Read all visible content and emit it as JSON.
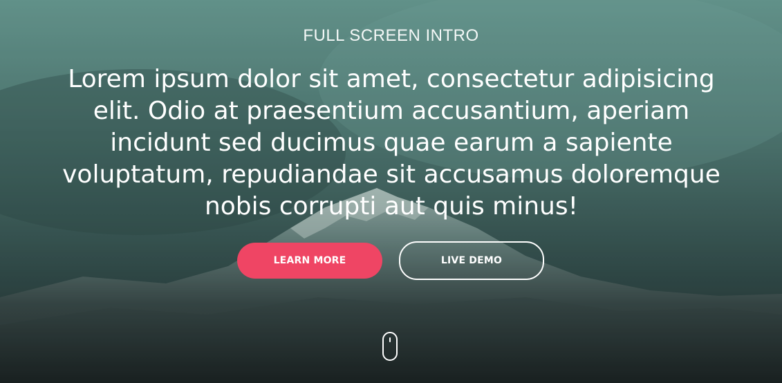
{
  "hero": {
    "eyebrow": "FULL SCREEN INTRO",
    "headline": "Lorem ipsum dolor sit amet, consectetur adipisicing elit. Odio at praesentium accusantium, aperiam incidunt sed ducimus quae earum a sapiente voluptatum, repudiandae sit accusamus doloremque nobis corrupti aut quis minus!",
    "primary_button": "LEARN MORE",
    "secondary_button": "LIVE DEMO",
    "scroll_indicator_icon": "mouse-scroll-icon"
  },
  "colors": {
    "accent": "#ef4564",
    "text": "#ffffff",
    "overlay": "#4f8a83"
  }
}
